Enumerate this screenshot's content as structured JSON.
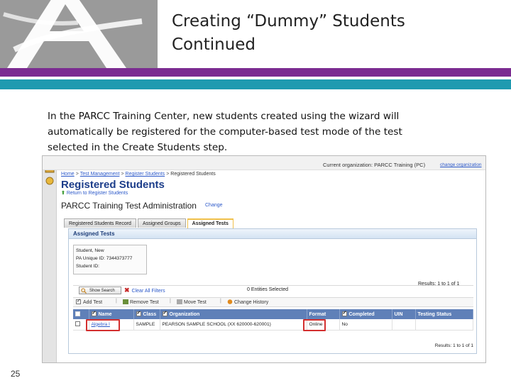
{
  "slide": {
    "title_line1": "Creating “Dummy” Students",
    "title_line2": "Continued",
    "intro": "In the PARCC Training Center,  new students created using the wizard will automatically be registered for the computer-based test mode of the test selected in the Create Students step.",
    "page_number": "25"
  },
  "colors": {
    "purple": "#7b2c91",
    "teal": "#1f9ab0",
    "heading_blue": "#1c3d8a",
    "grid_header": "#5f80b8",
    "highlight_red": "#d32f2f"
  },
  "screenshot": {
    "current_org": "Current organization: PARCC Training (PC)",
    "change_org": "change organization",
    "breadcrumb": {
      "home": "Home",
      "test_management": "Test Management",
      "register_students": "Register Students",
      "current": "Registered Students"
    },
    "page_heading": "Registered Students",
    "return_link": "Return to Register Students",
    "admin_title": "PARCC Training Test Administration",
    "admin_change": "Change",
    "tabs": [
      {
        "label": "Registered Students Record"
      },
      {
        "label": "Assigned Groups"
      },
      {
        "label": "Assigned Tests"
      }
    ],
    "panel_title": "Assigned Tests",
    "student": {
      "name": "Student, New",
      "pa_id": "PA Unique ID: 7344373777",
      "student_id": "Student ID:"
    },
    "toolbar": {
      "show_search": "Show Search",
      "clear_filters": "Clear All Filters",
      "entities_selected": "0 Entities Selected",
      "results": "Results: 1 to 1 of 1",
      "add_test": "Add Test",
      "remove_test": "Remove Test",
      "move_test": "Move Test",
      "change_history": "Change History"
    },
    "grid": {
      "columns": [
        "Name",
        "Class",
        "Organization",
        "Format",
        "Completed",
        "UIN",
        "Testing Status"
      ],
      "rows": [
        {
          "name": "Algebra I",
          "class": "SAMPLE",
          "organization": "PEARSON SAMPLE SCHOOL (XX 620000-620001)",
          "format": "Online",
          "completed": "No",
          "uin": "",
          "testing_status": ""
        }
      ],
      "footer": "Results: 1 to 1 of 1"
    }
  }
}
